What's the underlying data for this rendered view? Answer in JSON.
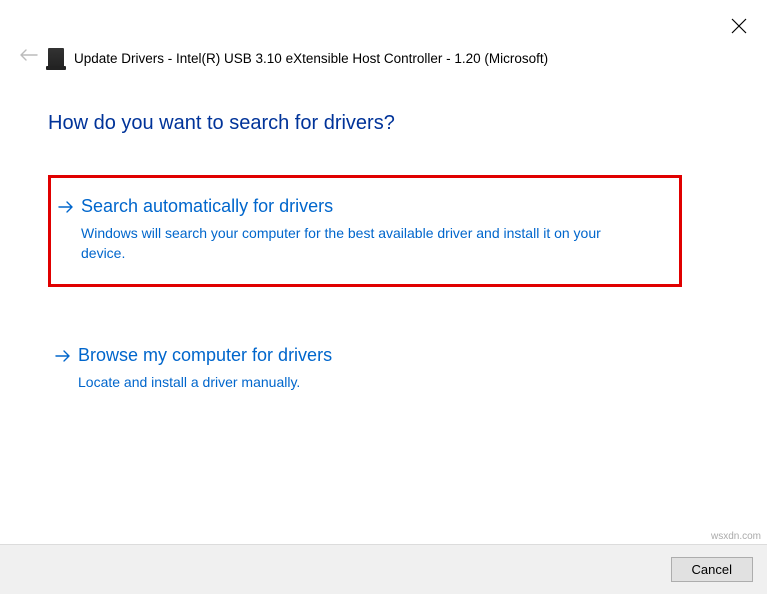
{
  "header": {
    "title": "Update Drivers - Intel(R) USB 3.10 eXtensible Host Controller - 1.20 (Microsoft)"
  },
  "prompt": "How do you want to search for drivers?",
  "options": [
    {
      "title": "Search automatically for drivers",
      "description": "Windows will search your computer for the best available driver and install it on your device.",
      "highlighted": true
    },
    {
      "title": "Browse my computer for drivers",
      "description": "Locate and install a driver manually.",
      "highlighted": false
    }
  ],
  "footer": {
    "cancel": "Cancel"
  },
  "watermark": "wsxdn.com"
}
